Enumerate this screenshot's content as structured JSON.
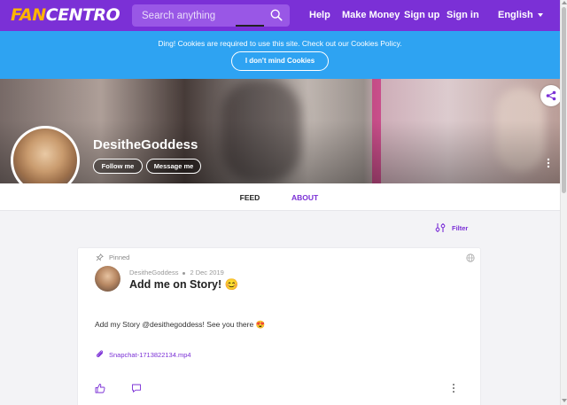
{
  "header": {
    "logo_part1": "FAN",
    "logo_part2": "CENTRO",
    "search_placeholder": "Search anything",
    "nav": {
      "help": "Help",
      "make_money": "Make Money",
      "sign_up": "Sign up",
      "sign_in": "Sign in",
      "language": "English"
    },
    "colors": {
      "bar": "#7b30d6",
      "logo_accent": "#ffb400"
    }
  },
  "cookie_banner": {
    "message": "Ding! Cookies are required to use this site. Check out our Cookies Policy.",
    "button_label": "I don't mind Cookies",
    "color": "#2ea3f2"
  },
  "profile": {
    "name": "DesitheGoddess",
    "follow_label": "Follow me",
    "message_label": "Message me",
    "share_icon": "share-icon"
  },
  "tabs": {
    "feed": "FEED",
    "about": "ABOUT",
    "active": "FEED"
  },
  "filter": {
    "label": "Filter",
    "icon": "sliders-icon"
  },
  "post": {
    "pinned_label": "Pinned",
    "author": "DesitheGoddess",
    "date": "2 Dec 2019",
    "title": "Add me on Story! 😊",
    "body": "Add my Story @desithegoddess! See you there 😍",
    "attachment": "Snapchat-1713822134.mp4",
    "actions": [
      "like-icon",
      "comment-icon",
      "more-icon"
    ]
  }
}
